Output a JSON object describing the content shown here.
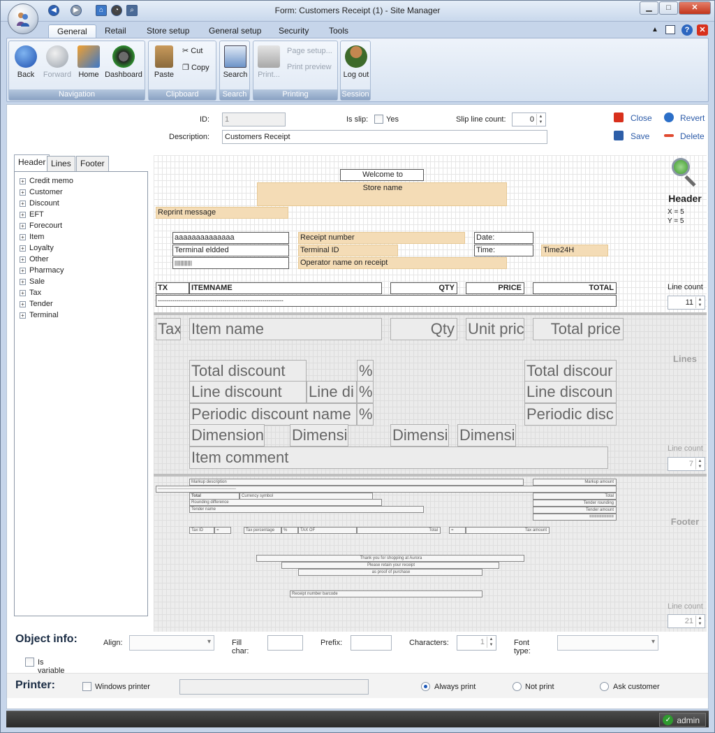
{
  "window": {
    "title": "Form: Customers Receipt (1) - Site Manager"
  },
  "ribbon": {
    "tabs": [
      "General",
      "Retail",
      "Store setup",
      "General setup",
      "Security",
      "Tools"
    ],
    "groups": {
      "navigation": {
        "label": "Navigation",
        "back": "Back",
        "forward": "Forward",
        "home": "Home",
        "dashboard": "Dashboard"
      },
      "clipboard": {
        "label": "Clipboard",
        "paste": "Paste",
        "cut": "Cut",
        "copy": "Copy"
      },
      "search": {
        "label": "Search",
        "search": "Search"
      },
      "printing": {
        "label": "Printing",
        "print": "Print...",
        "page_setup": "Page setup...",
        "print_preview": "Print preview"
      },
      "session": {
        "label": "Session",
        "logout": "Log out"
      }
    }
  },
  "form": {
    "id_label": "ID:",
    "id_value": "1",
    "is_slip_label": "Is slip:",
    "yes_label": "Yes",
    "slip_line_count_label": "Slip line count:",
    "slip_line_count": "0",
    "description_label": "Description:",
    "description": "Customers Receipt",
    "close": "Close",
    "revert": "Revert",
    "save": "Save",
    "delete": "Delete"
  },
  "left_tabs": [
    "Header",
    "Lines",
    "Footer"
  ],
  "tree": [
    "Credit memo",
    "Customer",
    "Discount",
    "EFT",
    "Forecourt",
    "Item",
    "Loyalty",
    "Other",
    "Pharmacy",
    "Sale",
    "Tax",
    "Tender",
    "Terminal"
  ],
  "header": {
    "title": "Header",
    "x_label": "X = 5",
    "y_label": "Y = 5",
    "line_count_label": "Line count",
    "line_count": "11",
    "welcome": "Welcome to",
    "store_name": "Store name",
    "reprint": "Reprint message",
    "aaa": "aaaaaaaaaaaaaa",
    "receipt_number": "Receipt number",
    "date": "Date:",
    "terminal_eldded": "Terminal eldded",
    "terminal_id": "Terminal ID",
    "time": "Time:",
    "time24h": "Time24H",
    "barcode": "||||||||||||",
    "operator": "Operator name on receipt",
    "tx": "TX",
    "itemname": "ITEMNAME",
    "qty": "QTY",
    "price": "PRICE",
    "total": "TOTAL",
    "dashes": "------------------------------------------------------------"
  },
  "lines": {
    "title": "Lines",
    "line_count_label": "Line count",
    "line_count": "7",
    "tax": "Tax",
    "item_name": "Item name",
    "qty": "Qty",
    "unit_price": "Unit pric",
    "total_price": "Total price",
    "total_discount": "Total discount",
    "pct": "%",
    "total_discount_r": "Total discour",
    "line_discount": "Line discount",
    "line_di": "Line di",
    "line_discount_r": "Line discoun",
    "periodic_discount_name": "Periodic discount name",
    "periodic_disc_r": "Periodic disc",
    "dimension": "Dimension",
    "dimensi": "Dimensi",
    "item_comment": "Item comment"
  },
  "footer": {
    "title": "Footer",
    "line_count_label": "Line count",
    "line_count": "21",
    "markup_description": "Markup description",
    "markup_amount": "Markup amount",
    "dashes": "--------------------------------------------------------",
    "total": "Total",
    "currency_symbol": "Currency symbol",
    "total_r": "Total",
    "rounding_difference": "Rounding difference",
    "tender_rounding": "Tender rounding",
    "tender_name": "Tender name",
    "tender_amount": "Tender amount",
    "equals": "==========",
    "tax_id": "Tax ID",
    "eq": "=",
    "tax_percentage": "Tax percentage",
    "pct": "%",
    "tax_of": "TAX OF",
    "total2": "Total",
    "eq2": "=",
    "tax_amount": "Tax amount",
    "thanks": "Thank you for shopping at Aurora",
    "retain": "Please retain your receipt",
    "proof": "as proof of purchase",
    "barcode": "Receipt number barcode"
  },
  "object_info": {
    "title": "Object info:",
    "align": "Align:",
    "fill_char": "Fill char:",
    "prefix": "Prefix:",
    "characters": "Characters:",
    "characters_value": "1",
    "font_type": "Font type:",
    "is_variable": "Is variable"
  },
  "printer": {
    "title": "Printer:",
    "windows_printer": "Windows printer",
    "always_print": "Always print",
    "not_print": "Not print",
    "ask_customer": "Ask customer"
  },
  "status": {
    "user": "admin"
  }
}
